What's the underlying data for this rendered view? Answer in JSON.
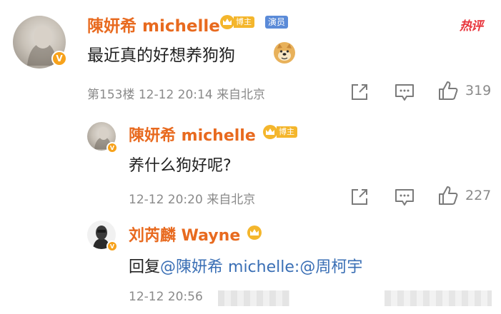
{
  "hot_label": "热评",
  "comment": {
    "username": "陳妍希 michelle",
    "blogger_badge": "博主",
    "actor_badge": "演员",
    "verified_mark": "V",
    "text": "最近真的好想养狗狗",
    "floor": "第153楼",
    "datetime": "12-12 20:14",
    "location": "来自北京",
    "like_count": "319"
  },
  "replies": [
    {
      "username": "陳妍希 michelle",
      "blogger_badge": "博主",
      "verified_mark": "V",
      "text": "养什么狗好呢?",
      "datetime": "12-12 20:20",
      "location": "来自北京",
      "like_count": "227"
    },
    {
      "username": "刘芮麟 Wayne",
      "verified_mark": "V",
      "reply_prefix": "回复",
      "mention_1": "@陳妍希 michelle",
      "mention_sep": ":",
      "mention_2": "@周柯宇",
      "datetime": "12-12 20:56"
    }
  ],
  "colors": {
    "username": "#e86a1f",
    "link": "#3a6fb5",
    "hot": "#e8343c",
    "meta": "#8a8a8a",
    "blogger_badge": "#f4b62c",
    "actor_badge": "#5b8bd8"
  },
  "icons": [
    "crown-icon",
    "doge-emoji-icon",
    "share-icon",
    "comment-icon",
    "thumbs-up-icon"
  ]
}
